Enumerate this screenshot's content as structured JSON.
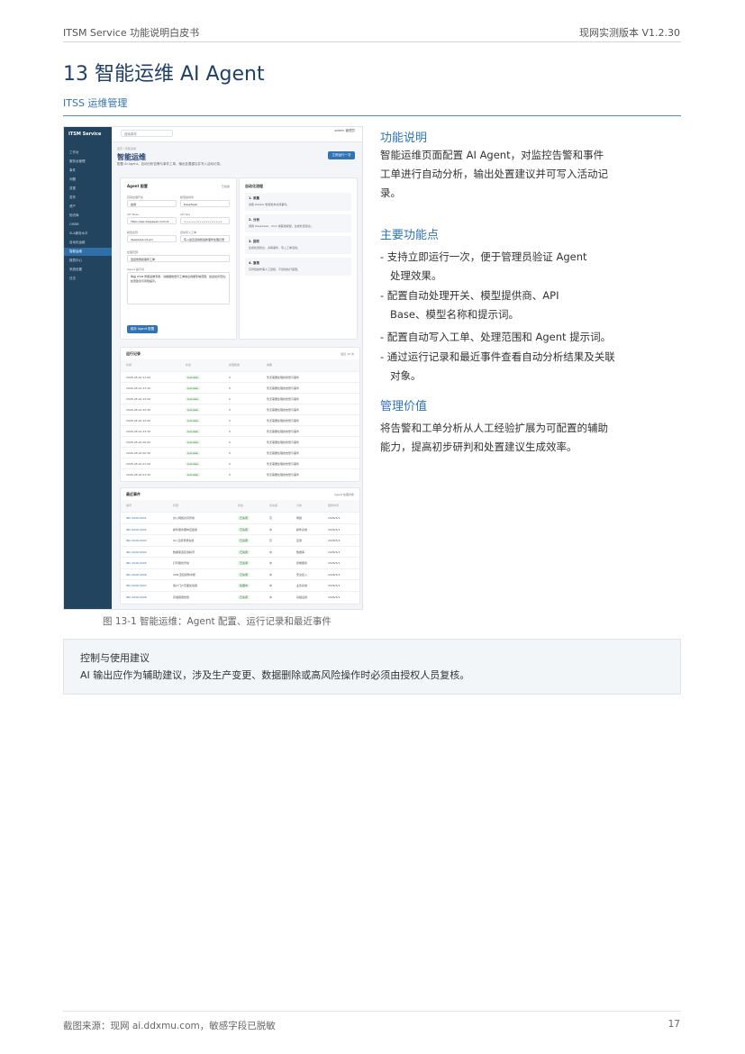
{
  "header": {
    "left": "ITSM Service 功能说明白皮书",
    "right": "现网实测版本 V1.2.30"
  },
  "section": {
    "title": "13 智能运维 AI Agent",
    "subtitle": "ITSS 运维管理"
  },
  "screenshot": {
    "logo": "ITSM Service",
    "sidebar_items": [
      "工作台",
      "服务台管理",
      "事件",
      "问题",
      "变更",
      "发布",
      "资产",
      "知识库",
      "CMDB",
      "SLA服务水平",
      "自动化运维",
      "智能运维",
      "报表中心",
      "系统设置",
      "日志"
    ],
    "search_placeholder": "搜索事件",
    "user": "admin 管理员",
    "crumb": "首页 / 智能运维",
    "page_title": "智能运维",
    "page_desc": "配置 AI Agent，自动分析告警与事件工单，输出处置建议并写入活动记录。",
    "run_button": "立即运行一次",
    "config": {
      "title": "Agent 配置",
      "status": "已启用",
      "fields": [
        {
          "label": "自动处理开关",
          "value": "启用"
        },
        {
          "label": "模型提供商",
          "value": "DeepSeek"
        },
        {
          "label": "API Base",
          "value": "https://api.deepseek.com/v1"
        },
        {
          "label": "API Key",
          "value": "••••••••••••••••••••••••"
        },
        {
          "label": "模型名称",
          "value": "deepseek-v4-pro"
        },
        {
          "label": "自动写入工单",
          "value": "写入最近活动和最新事件处理记录"
        },
        {
          "label": "处理范围",
          "value": "监控告警和事件工单"
        },
        {
          "label": "Agent 提示词",
          "value": "你是 ITSM 智能运维专家，请根据告警与工单信息判断影响范围，给出初步定位、处置建议与风险提示。"
        }
      ],
      "save_button": "保存 Agent 配置"
    },
    "flow": {
      "title": "自动化流程",
      "steps": [
        {
          "title": "1. 采集",
          "desc": "读取 Zabbix 告警和未关闭事件。"
        },
        {
          "title": "2. 分析",
          "desc": "调用 DeepSeek、Kimi 或其他模型，生成处置建议。"
        },
        {
          "title": "3. 回写",
          "desc": "生成处置建议、关联事件，写入工单活动。"
        },
        {
          "title": "4. 复核",
          "desc": "高风险操作需人工复核，不自动执行变更。"
        }
      ]
    },
    "runs": {
      "title": "运行记录",
      "count": "最近 10 次",
      "columns": [
        "时间",
        "状态",
        "处理数量",
        "摘要"
      ],
      "rows": [
        [
          "2026-05-01 21:00",
          "success",
          "0",
          "暂无需要处理的告警与事件"
        ],
        [
          "2026-05-01 21:30",
          "success",
          "0",
          "暂无需要处理的告警与事件"
        ],
        [
          "2026-05-01 22:00",
          "success",
          "0",
          "暂无需要处理的告警与事件"
        ],
        [
          "2026-05-01 22:30",
          "success",
          "0",
          "暂无需要处理的告警与事件"
        ],
        [
          "2026-05-01 23:00",
          "success",
          "0",
          "暂无需要处理的告警与事件"
        ],
        [
          "2026-05-01 23:30",
          "success",
          "0",
          "暂无需要处理的告警与事件"
        ],
        [
          "2026-05-02 00:00",
          "success",
          "0",
          "暂无需要处理的告警与事件"
        ],
        [
          "2026-05-02 00:30",
          "success",
          "0",
          "暂无需要处理的告警与事件"
        ],
        [
          "2026-05-02 01:00",
          "success",
          "0",
          "暂无需要处理的告警与事件"
        ],
        [
          "2026-05-02 01:30",
          "success",
          "0",
          "暂无需要处理的告警与事件"
        ]
      ]
    },
    "events": {
      "title": "最近事件",
      "more": "Agent 处理对象",
      "columns": [
        "编号",
        "标题",
        "状态",
        "优先级",
        "分类",
        "更新时间"
      ],
      "rows": [
        [
          "INC-2026-0001",
          "办公网络访问异常",
          "已关闭",
          "高",
          "网络",
          "2026/5/1"
        ],
        [
          "INC-2026-0002",
          "邮件服务器响应缓慢",
          "已关闭",
          "中",
          "邮件系统",
          "2026/5/1"
        ],
        [
          "INC-2026-0003",
          "OA 应用登录失败",
          "已关闭",
          "高",
          "应用",
          "2026/5/1"
        ],
        [
          "INC-2026-0004",
          "数据库连接池耗尽",
          "已关闭",
          "中",
          "数据库",
          "2026/5/1"
        ],
        [
          "INC-2026-0005",
          "打印服务异常",
          "已关闭",
          "中",
          "终端服务",
          "2026/5/1"
        ],
        [
          "INC-2026-0006",
          "VPN 连接频繁中断",
          "已关闭",
          "中",
          "安全接入",
          "2026/5/1"
        ],
        [
          "INC-2026-0007",
          "客户门户页面加载慢",
          "处理中",
          "中",
          "业务系统",
          "2026/5/1"
        ],
        [
          "INC-2026-0008",
          "存储容量告警",
          "已关闭",
          "中",
          "基础设施",
          "2026/5/1"
        ]
      ]
    }
  },
  "caption": "图 13-1 智能运维：Agent 配置、运行记录和最近事件",
  "description": {
    "title": "功能说明",
    "lines": [
      "智能运维页面配置 AI Agent，对监控告警和事件",
      "工单进行自动分析，输出处置建议并可写入活动记",
      "录。"
    ]
  },
  "features": {
    "title": "主要功能点",
    "items": [
      [
        "- 支持立即运行一次，便于管理员验证 Agent",
        "处理效果。"
      ],
      [
        "- 配置自动处理开关、模型提供商、API",
        "Base、模型名称和提示词。"
      ],
      [
        "- 配置自动写入工单、处理范围和 Agent 提示词。"
      ],
      [
        "- 通过运行记录和最近事件查看自动分析结果及关联",
        "对象。"
      ]
    ]
  },
  "value": {
    "title": "管理价值",
    "lines": [
      "将告警和工单分析从人工经验扩展为可配置的辅助",
      "能力，提高初步研判和处置建议生成效率。"
    ]
  },
  "note": {
    "title": "控制与使用建议",
    "body": "AI 输出应作为辅助建议，涉及生产变更、数据删除或高风险操作时必须由授权人员复核。"
  },
  "footer": {
    "left": "截图来源：现网 ai.ddxmu.com，敏感字段已脱敏",
    "page": "17"
  }
}
